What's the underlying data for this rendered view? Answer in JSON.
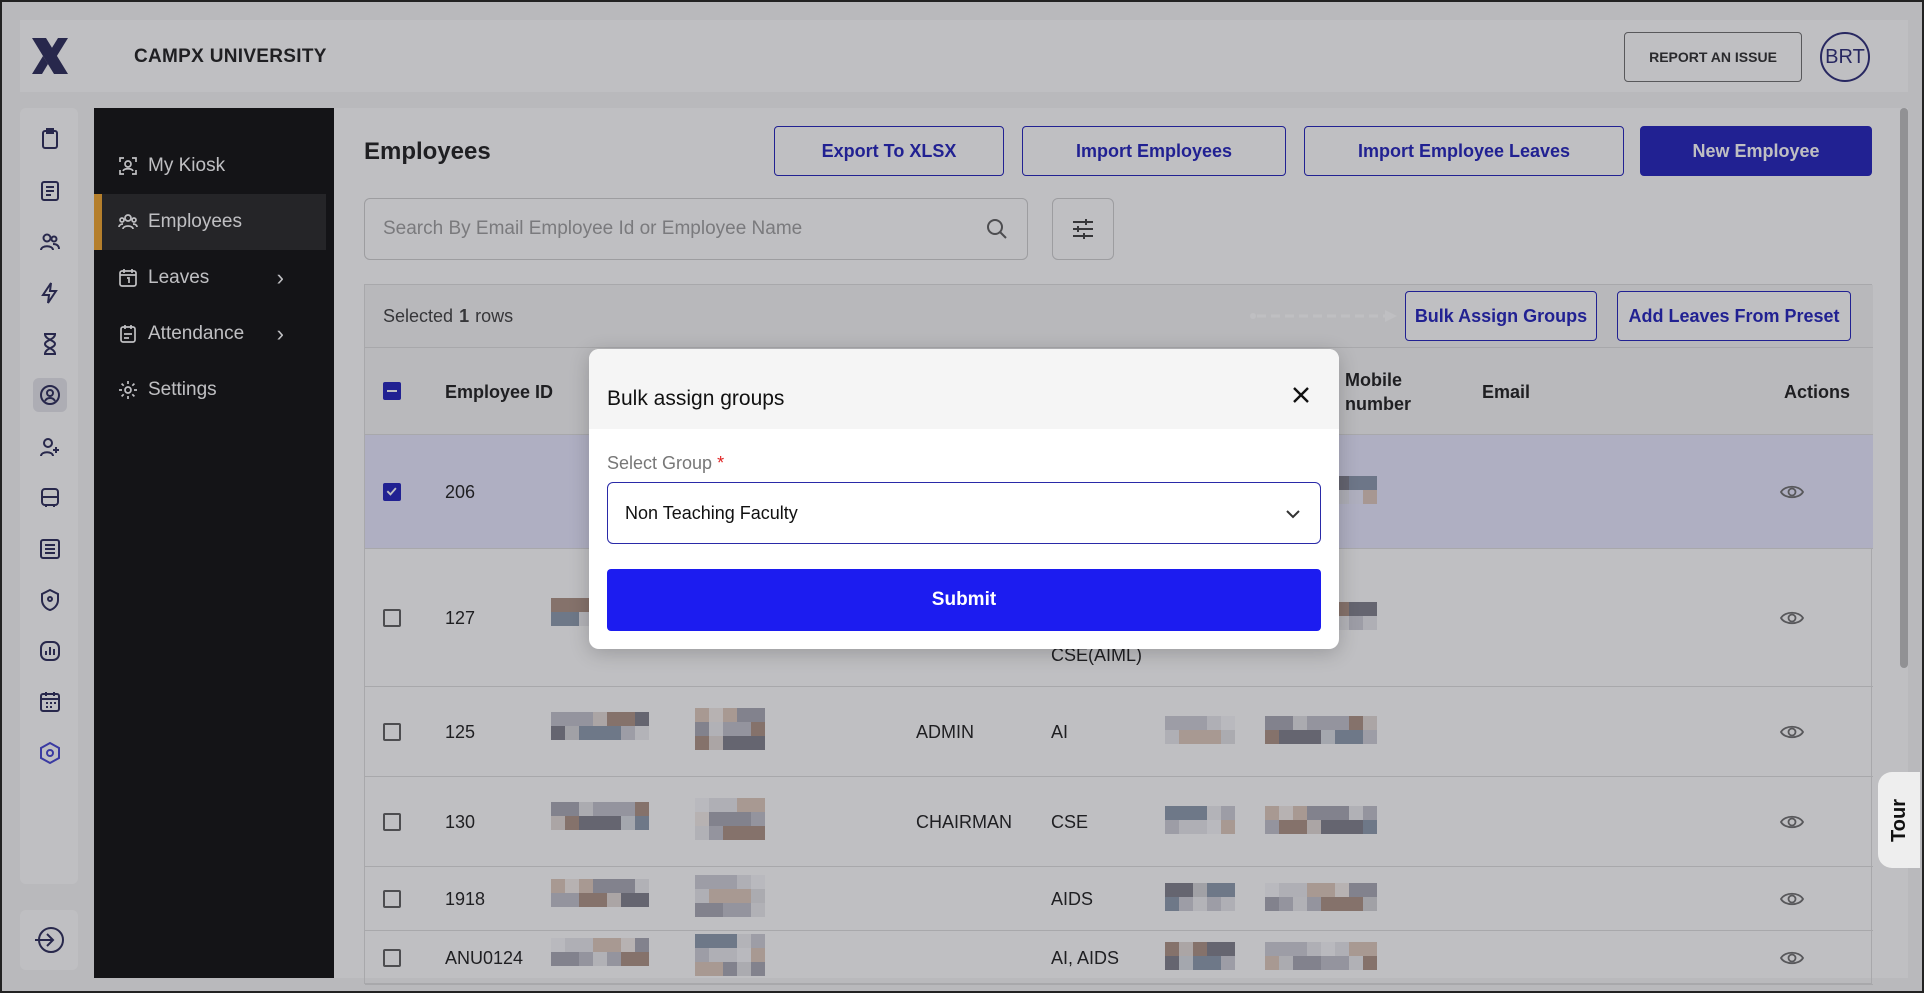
{
  "app": {
    "brand": "CAMPX UNIVERSITY",
    "report_label": "REPORT AN ISSUE",
    "avatar_initials": "BRT"
  },
  "rail_icons": [
    "clipboard-icon",
    "book-icon",
    "users-icon",
    "bolt-icon",
    "hourglass-icon",
    "user-badge-icon",
    "user-plus-icon",
    "bus-icon",
    "ledger-icon",
    "shield-icon",
    "analytics-icon",
    "calendar-icon",
    "settings-hex-icon"
  ],
  "sidenav": {
    "items": [
      {
        "label": "My Kiosk",
        "icon": "kiosk-icon"
      },
      {
        "label": "Employees",
        "icon": "employees-icon",
        "active": true
      },
      {
        "label": "Leaves",
        "icon": "calendar-icon",
        "has_children": true
      },
      {
        "label": "Attendance",
        "icon": "attendance-icon",
        "has_children": true
      },
      {
        "label": "Settings",
        "icon": "gear-icon"
      }
    ]
  },
  "page": {
    "title": "Employees",
    "buttons": {
      "export": "Export To XLSX",
      "import_employees": "Import Employees",
      "import_leaves": "Import Employee Leaves",
      "new_employee": "New Employee"
    },
    "search_placeholder": "Search By Email Employee Id or Employee Name"
  },
  "selection": {
    "prefix": "Selected",
    "count": "1",
    "suffix": "rows",
    "bulk_assign": "Bulk Assign Groups",
    "add_leaves": "Add Leaves From Preset"
  },
  "table": {
    "headers": {
      "employee_id": "Employee ID",
      "mobile": "Mobile number",
      "email": "Email",
      "actions": "Actions"
    },
    "rows": [
      {
        "id": "206",
        "designation": "",
        "department": "",
        "selected": true
      },
      {
        "id": "127",
        "designation": "",
        "department": "CSE(AIML)",
        "selected": false
      },
      {
        "id": "125",
        "designation": "ADMIN",
        "department": "AI",
        "selected": false
      },
      {
        "id": "130",
        "designation": "CHAIRMAN",
        "department": "CSE",
        "selected": false
      },
      {
        "id": "1918",
        "designation": "",
        "department": "AIDS",
        "selected": false
      },
      {
        "id": "ANU0124",
        "designation": "",
        "department": "AI, AIDS",
        "selected": false
      }
    ]
  },
  "tour_label": "Tour",
  "modal": {
    "title": "Bulk assign groups",
    "field_label": "Select Group",
    "required_mark": "*",
    "selected_value": "Non Teaching Faculty",
    "submit_label": "Submit"
  },
  "colors": {
    "primary": "#1414b8",
    "submit": "#1c1cf0",
    "accent": "#f0a020"
  }
}
